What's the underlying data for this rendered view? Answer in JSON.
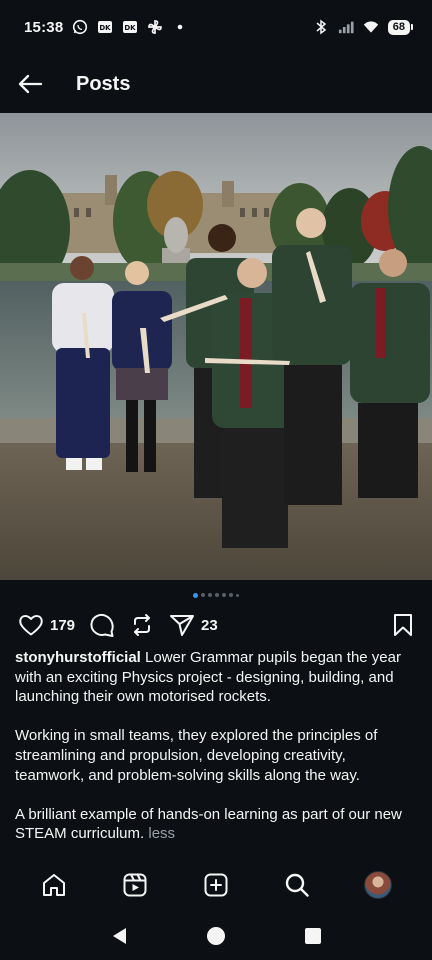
{
  "status_bar": {
    "time": "15:38",
    "left_icons": [
      "whatsapp-icon",
      "news-icon",
      "news-icon",
      "pinwheel-icon",
      "dot-icon"
    ],
    "right_icons": [
      "bluetooth-icon",
      "signal-icon",
      "wifi-icon"
    ],
    "battery": "68"
  },
  "header": {
    "title": "Posts",
    "back_icon": "arrow-left-icon"
  },
  "post": {
    "image_description_icon": "photo",
    "carousel": {
      "count": 7,
      "active": 0
    },
    "likes": "179",
    "shares": "23",
    "caption": {
      "username": "stonyhurstofficial",
      "text_1": " Lower Grammar pupils began the year with an exciting Physics project - designing, building, and launching their own motorised rockets.",
      "text_2": "Working in small teams, they explored the principles of streamlining and propulsion, developing creativity, teamwork, and problem-solving skills along the way.",
      "text_3": "A brilliant example of hands-on learning as part of our new STEAM curriculum.",
      "less_label": "less"
    }
  },
  "bottom_nav": {
    "items": [
      "home-icon",
      "reels-icon",
      "create-icon",
      "search-icon",
      "profile-avatar"
    ]
  },
  "system_nav": [
    "back-triangle-icon",
    "home-circle-icon",
    "recents-square-icon"
  ],
  "colors": {
    "background": "#0c1014",
    "text": "#f5f5f5",
    "accent_dot": "#3897f0",
    "muted": "#9aa0a6"
  }
}
